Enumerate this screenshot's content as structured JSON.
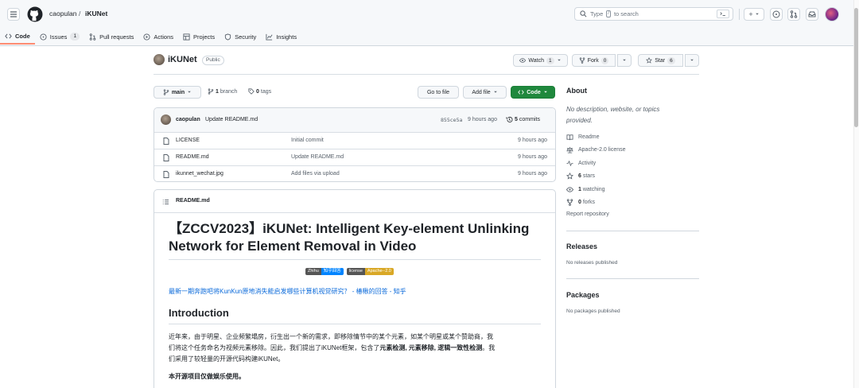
{
  "header": {
    "owner": "caopulan",
    "separator": "/",
    "repo_name": "iKUNet",
    "search_placeholder_pre": "Type",
    "search_key": "/",
    "search_placeholder_post": "to search",
    "plus_label": "+"
  },
  "tabs": [
    {
      "label": "Code",
      "icon": "code-icon",
      "active": true
    },
    {
      "label": "Issues",
      "icon": "issue-icon",
      "count": "1"
    },
    {
      "label": "Pull requests",
      "icon": "pull-request-icon"
    },
    {
      "label": "Actions",
      "icon": "play-icon"
    },
    {
      "label": "Projects",
      "icon": "table-icon"
    },
    {
      "label": "Security",
      "icon": "shield-icon"
    },
    {
      "label": "Insights",
      "icon": "graph-icon"
    }
  ],
  "repo": {
    "name": "iKUNet",
    "visibility": "Public",
    "watch_label": "Watch",
    "watch_count": "1",
    "fork_label": "Fork",
    "fork_count": "0",
    "star_label": "Star",
    "star_count": "6"
  },
  "toolbar": {
    "branch": "main",
    "branch_count": "1",
    "branch_word": "branch",
    "tag_count": "0",
    "tag_word": "tags",
    "go_to_file": "Go to file",
    "add_file": "Add file",
    "code": "Code"
  },
  "commit": {
    "author": "caopulan",
    "message": "Update README.md",
    "hash": "855ce5a",
    "time": "9 hours ago",
    "count": "5",
    "count_word": "commits"
  },
  "files": [
    {
      "name": "LICENSE",
      "message": "Initial commit",
      "time": "9 hours ago"
    },
    {
      "name": "README.md",
      "message": "Update README.md",
      "time": "9 hours ago"
    },
    {
      "name": "ikunnet_wechat.jpg",
      "message": "Add files via upload",
      "time": "9 hours ago"
    }
  ],
  "readme": {
    "file_label": "README.md",
    "title_line1": "【ZCCV2023】iKUNet: Intelligent Key-element Unlinking",
    "title_line2": "Network for Element Removal in Video",
    "badge1_left": "Zhihu",
    "badge1_right": "知乎回答",
    "badge2_left": "license",
    "badge2_right": "Apache--2.0",
    "zhihu_link": "最新一期奔跑吧将KunKun原地消失能启发哪些计算机视觉研究？ - 椿楸的回答 - 知乎",
    "intro_heading": "Introduction",
    "intro_p1_a": "近年来，由于明星、企业频繁塌房，衍生出一个新的需求，即移除情节中的某个元素，如某个明星或某个赞助商，我",
    "intro_p1_b": "们将这个任务命名为视频元素移除。因此，我们提出了iKUNet框架，包含了",
    "intro_p1_bold": "元素检测, 元素移除, 逻辑一致性检测",
    "intro_p1_c": "。我",
    "intro_p1_d": "们采用了较轻量的开源代码构建iKUNet。",
    "notice": "本开源项目仅做娱乐使用。"
  },
  "sidebar": {
    "about_heading": "About",
    "description_line1": "No description, website, or topics",
    "description_line2": "provided.",
    "items": [
      {
        "label": "Readme",
        "icon": "book-icon"
      },
      {
        "label": "Apache-2.0 license",
        "icon": "law-icon"
      },
      {
        "label": "Activity",
        "icon": "pulse-icon"
      },
      {
        "count": "6",
        "label": "stars",
        "icon": "star-icon"
      },
      {
        "count": "1",
        "label": "watching",
        "icon": "eye-icon"
      },
      {
        "count": "0",
        "label": "forks",
        "icon": "fork-icon"
      }
    ],
    "report": "Report repository",
    "releases_heading": "Releases",
    "releases_text": "No releases published",
    "packages_heading": "Packages",
    "packages_text": "No packages published"
  },
  "colors": {
    "green": "#1f883d",
    "link": "#0969da",
    "tab_underline": "#fd8c73"
  }
}
